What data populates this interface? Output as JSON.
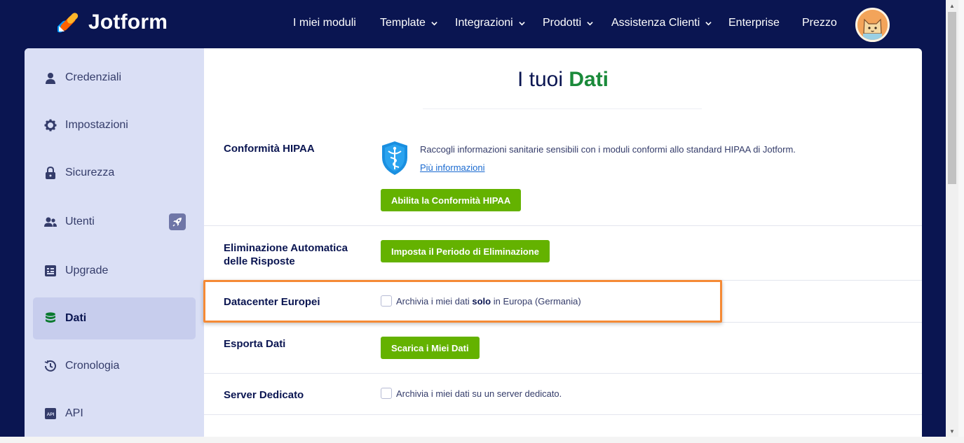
{
  "brand": {
    "name": "Jotform"
  },
  "nav": {
    "items": [
      {
        "label": "I miei moduli",
        "dropdown": false
      },
      {
        "label": "Template",
        "dropdown": true
      },
      {
        "label": "Integrazioni",
        "dropdown": true
      },
      {
        "label": "Prodotti",
        "dropdown": true
      },
      {
        "label": "Assistenza Clienti",
        "dropdown": true
      },
      {
        "label": "Enterprise",
        "dropdown": false
      },
      {
        "label": "Prezzo",
        "dropdown": false
      }
    ]
  },
  "sidebar": {
    "items": [
      {
        "label": "Credenziali",
        "icon": "user-icon",
        "active": false
      },
      {
        "label": "Impostazioni",
        "icon": "gear-icon",
        "active": false
      },
      {
        "label": "Sicurezza",
        "icon": "lock-icon",
        "active": false
      },
      {
        "label": "Utenti",
        "icon": "users-icon",
        "active": false,
        "badge_icon": "rocket-icon"
      },
      {
        "label": "Upgrade",
        "icon": "upgrade-icon",
        "active": false
      },
      {
        "label": "Dati",
        "icon": "database-icon",
        "active": true
      },
      {
        "label": "Cronologia",
        "icon": "history-icon",
        "active": false
      },
      {
        "label": "API",
        "icon": "api-icon",
        "active": false
      }
    ]
  },
  "page": {
    "title_prefix": "I tuoi",
    "title_accent": "Dati"
  },
  "sections": {
    "hipaa": {
      "label": "Conformità HIPAA",
      "description": "Raccogli informazioni sanitarie sensibili con i moduli conformi allo standard HIPAA di Jotform.",
      "link": "Più informazioni",
      "button": "Abilita la Conformità HIPAA"
    },
    "auto_delete": {
      "label_line1": "Eliminazione Automatica",
      "label_line2": "delle Risposte",
      "button": "Imposta il Periodo di Eliminazione"
    },
    "eu_datacenter": {
      "label": "Datacenter Europei",
      "check_before": "Archivia i miei dati ",
      "check_bold": "solo",
      "check_after": " in Europa (Germania)",
      "checked": false
    },
    "export": {
      "label": "Esporta Dati",
      "button": "Scarica i Miei Dati"
    },
    "dedicated": {
      "label": "Server Dedicato",
      "check_text": "Archivia i miei dati su un server dedicato.",
      "checked": false
    }
  },
  "colors": {
    "navy": "#0a1551",
    "green_button": "#64b200",
    "accent_green": "#1a8a3a",
    "highlight": "#f58a35",
    "sidebar_bg": "#dadff5",
    "sidebar_active": "#c7cded"
  }
}
